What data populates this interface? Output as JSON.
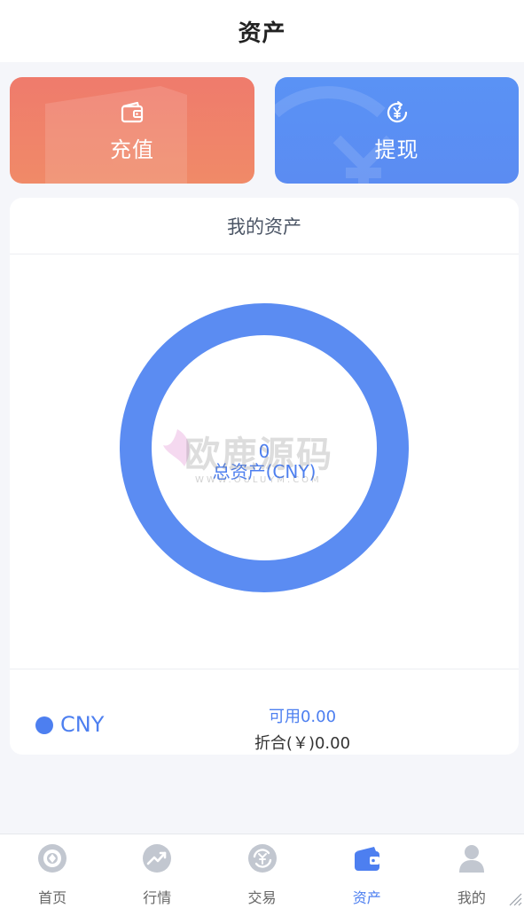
{
  "header": {
    "title": "资产"
  },
  "actions": {
    "recharge_label": "充值",
    "withdraw_label": "提现"
  },
  "assets": {
    "panel_title": "我的资产",
    "total_value": "0",
    "total_label": "总资产(CNY)",
    "chart_color": "#5b8cf2"
  },
  "currency": {
    "code": "CNY",
    "available": "可用0.00",
    "converted": "折合(￥)0.00"
  },
  "watermark": {
    "text": "欧鹿源码",
    "sub": "WWW.OULUYM.COM"
  },
  "tabs": [
    {
      "label": "首页",
      "icon": "home-icon"
    },
    {
      "label": "行情",
      "icon": "market-icon"
    },
    {
      "label": "交易",
      "icon": "trade-icon"
    },
    {
      "label": "资产",
      "icon": "wallet-icon",
      "active": true
    },
    {
      "label": "我的",
      "icon": "user-icon"
    }
  ],
  "colors": {
    "accent": "#4d7ff0",
    "recharge": "#ef7b6c",
    "withdraw": "#5b8cf2",
    "inactive_icon": "#c2c7d0"
  }
}
